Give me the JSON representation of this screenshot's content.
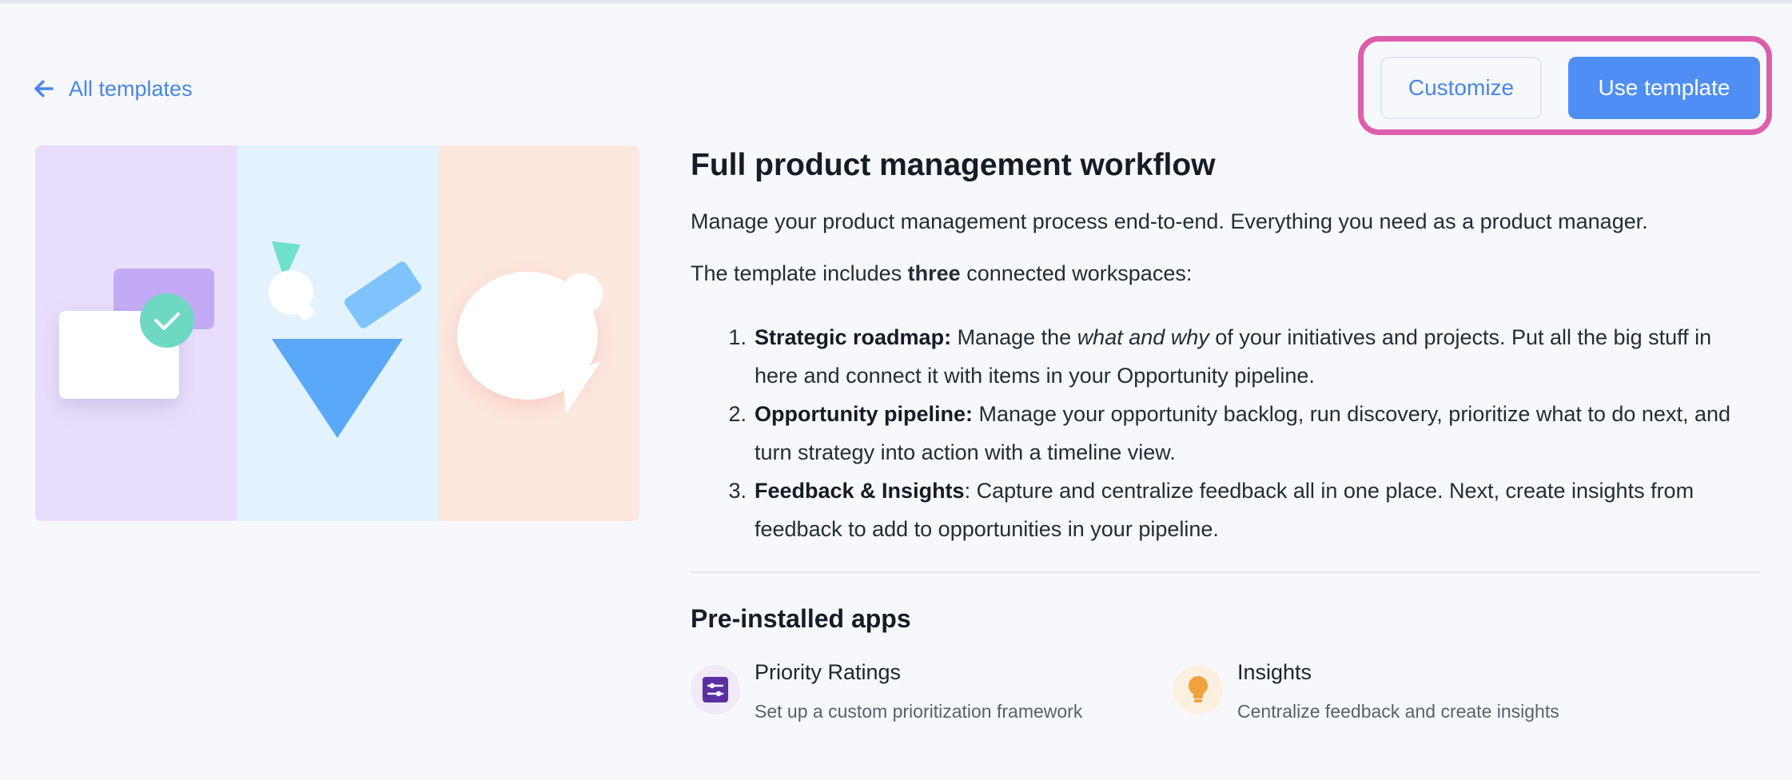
{
  "nav": {
    "back_label": "All templates"
  },
  "actions": {
    "customize_label": "Customize",
    "use_template_label": "Use template"
  },
  "template": {
    "title": "Full product management workflow",
    "description": "Manage your product management process end-to-end. Everything you need as a product manager.",
    "includes_prefix": "The template includes ",
    "includes_bold": "three",
    "includes_suffix": " connected workspaces:",
    "steps": [
      {
        "number": "1.",
        "name": "Strategic roadmap:",
        "text_before": " Manage the ",
        "text_italic": "what and why",
        "text_after": " of your initiatives and projects. Put all the big stuff in here and connect it with items in your Opportunity pipeline."
      },
      {
        "number": "2.",
        "name": "Opportunity pipeline:",
        "text": " Manage your opportunity backlog, run discovery, prioritize what to do next, and turn strategy into action with a timeline view."
      },
      {
        "number": "3.",
        "name": "Feedback & Insights",
        "text": ": Capture and centralize feedback all in one place. Next, create insights from feedback to add to opportunities in your pipeline."
      }
    ]
  },
  "apps": {
    "title": "Pre-installed apps",
    "items": [
      {
        "name": "Priority Ratings",
        "description": "Set up a custom prioritization framework",
        "icon": "sliders-icon",
        "color": "#5b2fa3"
      },
      {
        "name": "Insights",
        "description": "Centralize feedback and create insights",
        "icon": "lightbulb-icon",
        "color": "#f2a23a"
      }
    ]
  },
  "colors": {
    "accent": "#4f8ff5",
    "link": "#4a86e8",
    "highlight": "#de5eae"
  }
}
